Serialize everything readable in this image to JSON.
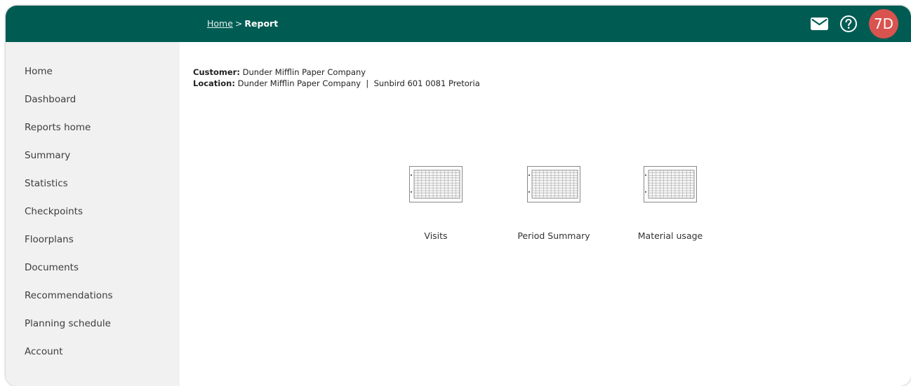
{
  "header": {
    "breadcrumb_home": "Home",
    "breadcrumb_separator": ">",
    "breadcrumb_current": "Report",
    "avatar_initials": "7D",
    "icons": [
      "mail-icon",
      "help-icon"
    ],
    "colors": {
      "bar": "#005c53",
      "avatar": "#d9534f"
    }
  },
  "sidebar": {
    "items": [
      {
        "label": "Home"
      },
      {
        "label": "Dashboard"
      },
      {
        "label": "Reports home"
      },
      {
        "label": "Summary"
      },
      {
        "label": "Statistics"
      },
      {
        "label": "Checkpoints"
      },
      {
        "label": "Floorplans"
      },
      {
        "label": "Documents"
      },
      {
        "label": "Recommendations"
      },
      {
        "label": "Planning schedule"
      },
      {
        "label": "Account"
      }
    ]
  },
  "info": {
    "customer_label": "Customer:",
    "customer_value": "Dunder Mifflin Paper Company",
    "location_label": "Location:",
    "location_value": "Dunder Mifflin Paper Company  |  Sunbird 601 0081 Pretoria"
  },
  "reports": [
    {
      "label": "Visits",
      "icon": "report-table-icon"
    },
    {
      "label": "Period Summary",
      "icon": "report-table-icon"
    },
    {
      "label": "Material usage",
      "icon": "report-table-icon"
    }
  ]
}
